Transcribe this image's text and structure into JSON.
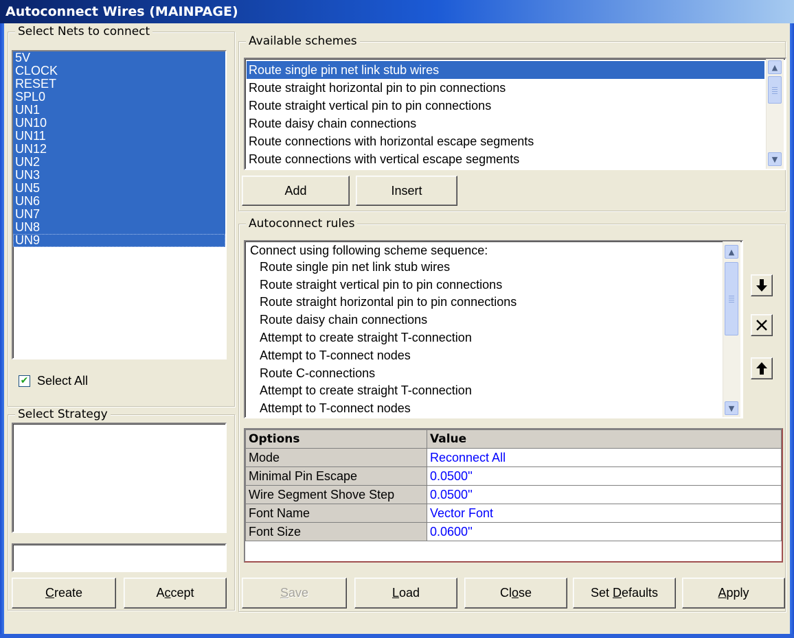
{
  "window": {
    "title": "Autoconnect Wires (MAINPAGE)"
  },
  "nets": {
    "legend": "Select Nets to connect",
    "items": [
      "5V",
      "CLOCK",
      "RESET",
      "SPL0",
      "UN1",
      "UN10",
      "UN11",
      "UN12",
      "UN2",
      "UN3",
      "UN5",
      "UN6",
      "UN7",
      "UN8",
      "UN9"
    ],
    "select_all_label": "Select All",
    "select_all_checked": true
  },
  "strategy": {
    "legend": "Select Strategy",
    "name_value": "",
    "create_label": "Create",
    "accept_label": "Accept"
  },
  "schemes": {
    "legend": "Available schemes",
    "items": [
      "Route single pin net link stub wires",
      "Route straight horizontal pin to pin connections",
      "Route straight vertical pin to pin connections",
      "Route daisy chain connections",
      "Route connections with horizontal escape segments",
      "Route connections with vertical escape segments"
    ],
    "selected_index": 0,
    "add_label": "Add",
    "insert_label": "Insert"
  },
  "rules": {
    "legend": "Autoconnect rules",
    "heading": "Connect using following scheme sequence:",
    "items": [
      "Route single pin net link stub wires",
      "Route straight vertical pin to pin connections",
      "Route straight horizontal pin to pin connections",
      "Route daisy chain connections",
      "Attempt to create straight T-connection",
      "Attempt to T-connect nodes",
      "Route C-connections",
      "Attempt to create straight T-connection",
      "Attempt to T-connect nodes"
    ],
    "icons": {
      "down": "arrow-down-icon",
      "delete": "x-delete-icon",
      "up": "arrow-up-icon"
    }
  },
  "options": {
    "headers": {
      "option": "Options",
      "value": "Value"
    },
    "rows": [
      {
        "key": "Mode",
        "value": "Reconnect All"
      },
      {
        "key": "Minimal Pin Escape",
        "value": "0.0500''"
      },
      {
        "key": "Wire Segment Shove Step",
        "value": "0.0500''"
      },
      {
        "key": "Font Name",
        "value": "Vector Font"
      },
      {
        "key": "Font Size",
        "value": "0.0600''"
      }
    ]
  },
  "footer": {
    "save_label": "Save",
    "load_label": "Load",
    "close_label": "Close",
    "set_defaults_label": "Set Defaults",
    "apply_label": "Apply"
  },
  "colors": {
    "selection": "#316ac5",
    "value_text": "#0000ff",
    "face": "#ece9d8"
  }
}
